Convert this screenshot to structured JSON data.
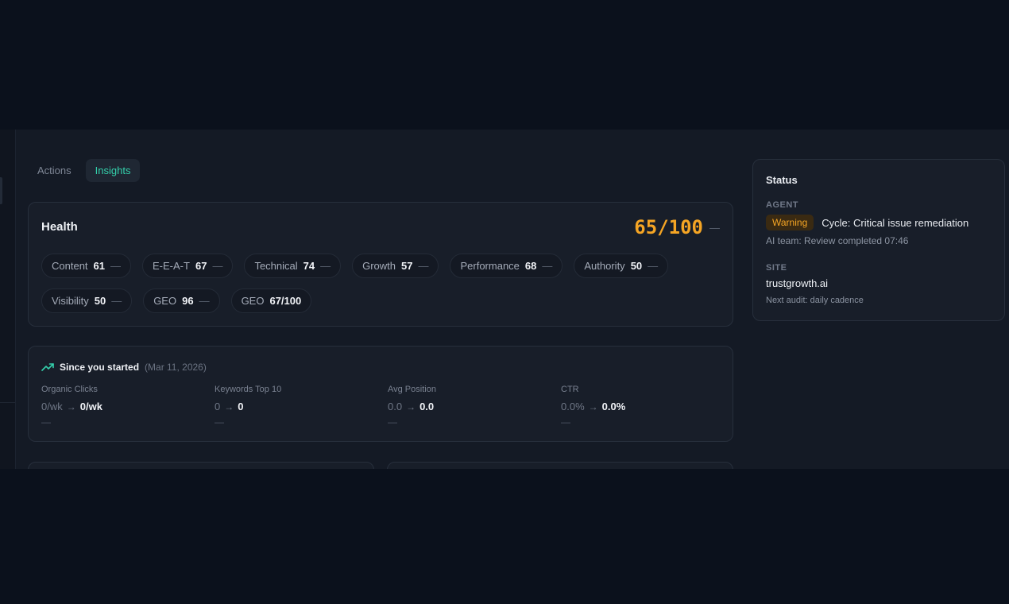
{
  "tabs": [
    {
      "label": "Actions",
      "active": false
    },
    {
      "label": "Insights",
      "active": true
    }
  ],
  "health": {
    "title": "Health",
    "score": "65/100",
    "score_trend": "—",
    "score_color": "#f5a524",
    "pills": [
      {
        "label": "Content",
        "value": "61",
        "trend": "—"
      },
      {
        "label": "E-E-A-T",
        "value": "67",
        "trend": "—"
      },
      {
        "label": "Technical",
        "value": "74",
        "trend": "—"
      },
      {
        "label": "Growth",
        "value": "57",
        "trend": "—"
      },
      {
        "label": "Performance",
        "value": "68",
        "trend": "—"
      },
      {
        "label": "Authority",
        "value": "50",
        "trend": "—"
      },
      {
        "label": "Visibility",
        "value": "50",
        "trend": "—"
      },
      {
        "label": "GEO",
        "value": "96",
        "trend": "—"
      },
      {
        "label": "GEO",
        "value": "67/100",
        "trend": ""
      }
    ]
  },
  "since_started": {
    "icon": "trending-up-icon",
    "title": "Since you started",
    "date": "(Mar 11, 2026)",
    "metrics": [
      {
        "label": "Organic Clicks",
        "from": "0/wk",
        "to": "0/wk",
        "sub": "—"
      },
      {
        "label": "Keywords Top 10",
        "from": "0",
        "to": "0",
        "sub": "—"
      },
      {
        "label": "Avg Position",
        "from": "0.0",
        "to": "0.0",
        "sub": "—"
      },
      {
        "label": "CTR",
        "from": "0.0%",
        "to": "0.0%",
        "sub": "—"
      }
    ]
  },
  "status": {
    "title": "Status",
    "agent_label": "AGENT",
    "badge": "Warning",
    "cycle": "Cycle: Critical issue remediation",
    "team": "AI team: Review completed 07:46",
    "site_label": "SITE",
    "site": "trustgrowth.ai",
    "audit": "Next audit: daily cadence"
  },
  "colors": {
    "accent": "#34d1ac",
    "warning": "#f5a524"
  }
}
